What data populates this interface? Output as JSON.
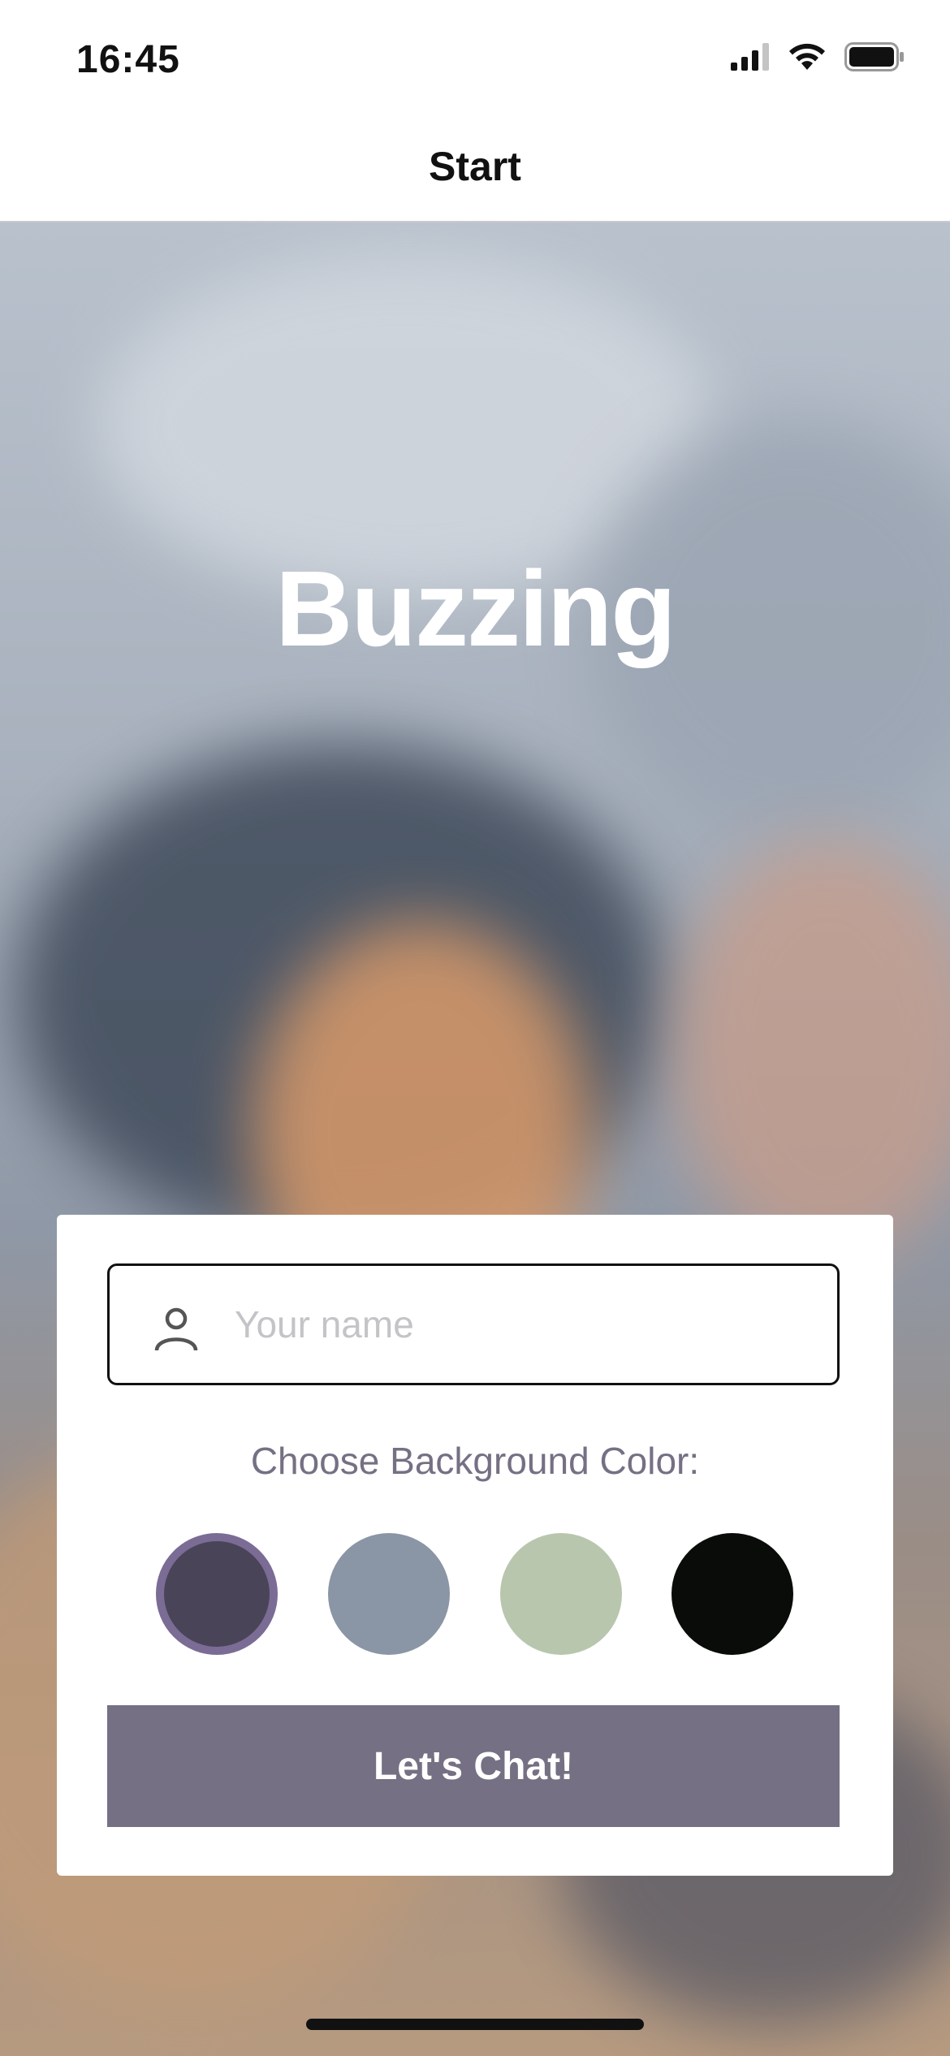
{
  "status_bar": {
    "time": "16:45",
    "icons": [
      "signal-icon",
      "wifi-icon",
      "battery-icon"
    ]
  },
  "nav": {
    "title": "Start"
  },
  "hero": {
    "app_title": "Buzzing"
  },
  "form": {
    "name_placeholder": "Your name",
    "name_value": "",
    "color_label": "Choose Background Color:",
    "swatches": [
      {
        "name": "swatch-dark-purple",
        "color": "#4a4458",
        "selected": true
      },
      {
        "name": "swatch-slate-blue",
        "color": "#8a95a5",
        "selected": false
      },
      {
        "name": "swatch-sage-green",
        "color": "#b9c6ae",
        "selected": false
      },
      {
        "name": "swatch-black",
        "color": "#090c08",
        "selected": false
      }
    ],
    "submit_label": "Let's Chat!"
  },
  "colors": {
    "accent": "#757083",
    "selected_ring": "#7b6c95"
  }
}
